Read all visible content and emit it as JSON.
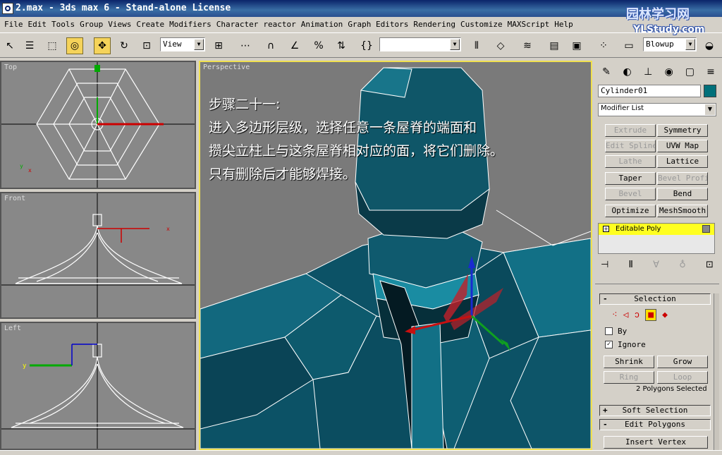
{
  "window": {
    "title": "2.max - 3ds max 6 - Stand-alone License"
  },
  "watermark": {
    "line1": "园林学习网",
    "line2": "YLStudy.com"
  },
  "menu": [
    "File",
    "Edit",
    "Tools",
    "Group",
    "Views",
    "Create",
    "Modifiers",
    "Character",
    "reactor",
    "Animation",
    "Graph Editors",
    "Rendering",
    "Customize",
    "MAXScript",
    "Help"
  ],
  "toolbar": {
    "ref_coord": "View",
    "render_type": "Blowup",
    "named_selection": ""
  },
  "viewports": {
    "top": "Top",
    "front": "Front",
    "left": "Left",
    "perspective": "Perspective"
  },
  "instruction": {
    "step": "步骤二十一:",
    "line1": "进入多边形层级，选择任意一条屋脊的端面和",
    "line2": "攒尖立柱上与这条屋脊相对应的面，将它们删除。",
    "line3": "只有删除后才能够焊接。"
  },
  "command_panel": {
    "object_name": "Cylinder01",
    "modifier_list": "Modifier List",
    "modifier_buttons": [
      "Extrude",
      "Symmetry",
      "Edit Spline",
      "UVW Map",
      "Lathe",
      "Lattice",
      "Taper",
      "Bevel Profile",
      "Bevel",
      "Bend",
      "Optimize",
      "MeshSmooth"
    ],
    "stack_item": "Editable Poly",
    "selection": {
      "header": "Selection",
      "by_label": "By",
      "ignore_label": "Ignore",
      "shrink": "Shrink",
      "grow": "Grow",
      "ring": "Ring",
      "loop": "Loop",
      "status": "2 Polygons Selected"
    },
    "soft_selection": "Soft Selection",
    "edit_polygons": "Edit Polygons",
    "insert_vertex": "Insert Vertex"
  },
  "colors": {
    "accent": "#f0e050",
    "object": "#0f5a6e",
    "selected": "#c0202a",
    "object_swatch": "#00707a"
  }
}
